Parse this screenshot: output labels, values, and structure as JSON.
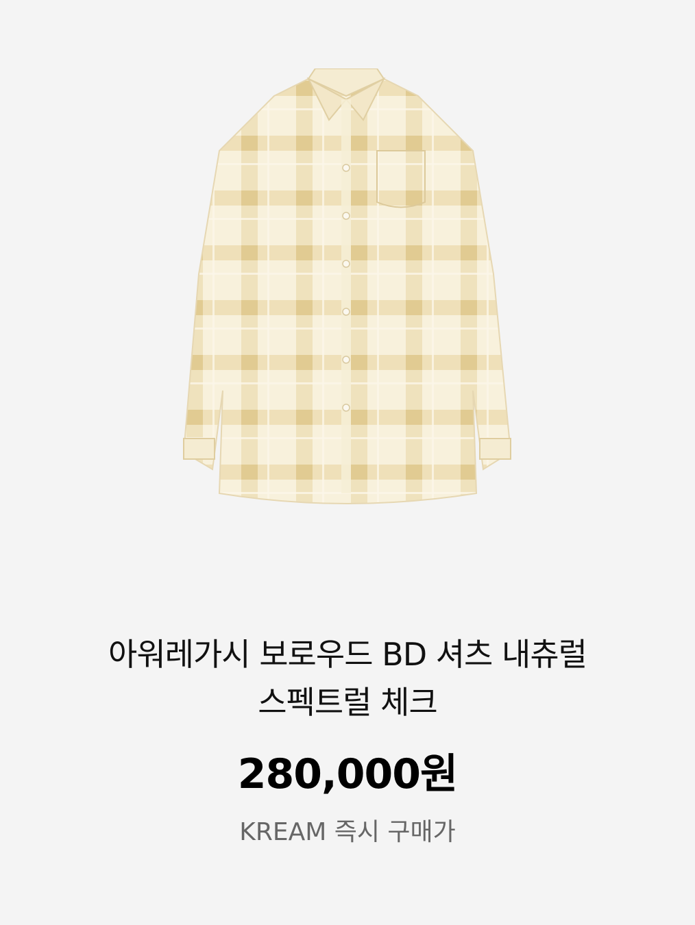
{
  "product": {
    "image_alt": "shirt-product-image",
    "title_line1": "아워레가시 보로우드 BD 셔츠 내츄럴",
    "title_line2": "스펙트럴 체크",
    "price": "280,000원",
    "price_caption": "KREAM 즉시 구매가"
  },
  "colors": {
    "background": "#f4f4f4",
    "shirt_base": "#f7efd8",
    "shirt_check": "#e8d5a4"
  }
}
